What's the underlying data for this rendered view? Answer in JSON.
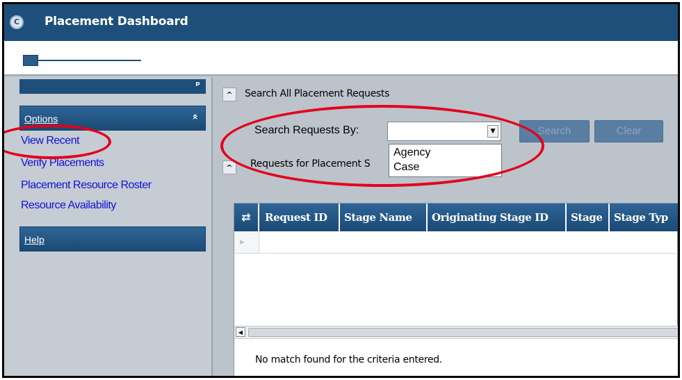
{
  "window": {
    "title": "Placement Dashboard",
    "logo_glyph": "C"
  },
  "sidebar": {
    "pin_glyph": "ᵖ",
    "options_header": "Options",
    "collapse_glyph": "«",
    "links": [
      "View Recent",
      "Verify Placements",
      "Placement Resource Roster",
      "Resource Availability"
    ],
    "help_header": "Help"
  },
  "search_section": {
    "toggle_glyph": "^",
    "title": "Search All Placement Requests",
    "search_by_label": "Search Requests By:",
    "selected_value": "",
    "dropdown_arrow": "▼",
    "dropdown_options": [
      "Agency",
      "Case"
    ],
    "search_button": "Search",
    "clear_button": "Clear"
  },
  "requests_section": {
    "toggle_glyph": "^",
    "title": "Requests for Placement S"
  },
  "grid": {
    "sort_glyph": "⇄",
    "columns": [
      "Request ID",
      "Stage Name",
      "Originating Stage ID",
      "Stage",
      "Stage Typ"
    ],
    "row_indicator": "▶",
    "scroll_left": "◀",
    "status_text": "No match found for the criteria entered."
  },
  "colors": {
    "title_bar": "#1e4f7a",
    "panel_background": "#bcc3ca",
    "link": "#1010d8",
    "annotation": "#e3001b",
    "disabled_button": "#5a7ea3"
  },
  "annotations": [
    "red-ellipse-around-view-recent",
    "red-ellipse-around-search-by-dropdown"
  ]
}
